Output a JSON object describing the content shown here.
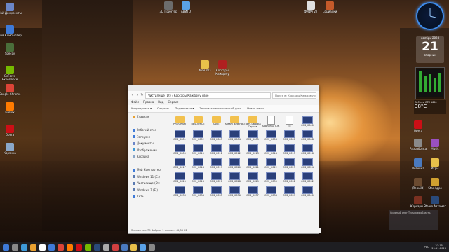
{
  "desktop_left": [
    {
      "label": "Мой Документы",
      "color": "#6b86c8"
    },
    {
      "label": "Мой Компьютер",
      "color": "#3e7ad8"
    },
    {
      "label": "Speccy",
      "color": "#4a6e3a"
    },
    {
      "label": "GeForce Experience",
      "color": "#76b900"
    },
    {
      "label": "Google Chrome",
      "color": "#db4437"
    },
    {
      "label": "Firefox",
      "color": "#ff7b00"
    },
    {
      "label": "Opera",
      "color": "#cc0f16"
    },
    {
      "label": "Корзина",
      "color": "#8aa7c8"
    }
  ],
  "desktop_top": [
    {
      "label": "3D Принтер",
      "color": "#6c6c6c"
    },
    {
      "label": "АВИТО",
      "color": "#5aa2e8"
    },
    {
      "label": "ФИФА 22",
      "color": "#e0e0e0"
    },
    {
      "label": "Социалки",
      "color": "#c45a2a"
    },
    {
      "label": "Мои ICO",
      "color": "#e8c04a"
    },
    {
      "label": "Корсары Каждому",
      "color": "#b02020"
    }
  ],
  "desktop_right": [
    {
      "label": "Opera",
      "color": "#cc0f16"
    },
    {
      "label": "Разработка",
      "color": "#8a8a8a"
    },
    {
      "label": "Music",
      "color": "#9a50c0"
    },
    {
      "label": "Всячина",
      "color": "#4a7ac0"
    },
    {
      "label": "Игры",
      "color": "#e8c04a"
    },
    {
      "label": "(Rebuild)",
      "color": "#6a4a30"
    },
    {
      "label": "Star Apps",
      "color": "#d0a030"
    },
    {
      "label": "Корсары 3",
      "color": "#7a3020"
    },
    {
      "label": "Steam Автомат",
      "color": "#2a4a7a"
    }
  ],
  "explorer": {
    "path": "Чистилище (D:)  ›  Корсары Каждому свое  ›",
    "search_placeholder": "Поиск в: Корсары Каждому с...",
    "menu": [
      "Файл",
      "Правка",
      "Вид",
      "Сервис"
    ],
    "toolbar": [
      "Упорядочить ▾",
      "Открыть",
      "Поделиться ▾",
      "Записать на оптический диск",
      "Новая папка"
    ],
    "sidebar": [
      {
        "label": "Главная",
        "color": "#e8a030"
      },
      {
        "label": "",
        "color": "transparent"
      },
      {
        "label": "Рабочий стол",
        "color": "#3e7ad8"
      },
      {
        "label": "Загрузки",
        "color": "#3e7ad8"
      },
      {
        "label": "Документы",
        "color": "#6b86c8"
      },
      {
        "label": "Изображения",
        "color": "#3e9ad8"
      },
      {
        "label": "Корзина",
        "color": "#8aa7c8"
      },
      {
        "label": "",
        "color": "transparent"
      },
      {
        "label": "Мой Компьютер",
        "color": "#3e7ad8"
      },
      {
        "label": "Windows 11 (C:)",
        "color": "#5a7ab0"
      },
      {
        "label": "Чистилище (D:)",
        "color": "#5a7ab0"
      },
      {
        "label": "Windows 7 (E:)",
        "color": "#5a7ab0"
      },
      {
        "label": "Сеть",
        "color": "#3e7ad8"
      }
    ],
    "items": [
      {
        "label": "PROGRAM",
        "kind": "folder"
      },
      {
        "label": "RESOURCE",
        "kind": "folder"
      },
      {
        "label": "SAVE",
        "kind": "folder"
      },
      {
        "label": "steam_settings",
        "kind": "folder"
      },
      {
        "label": "Патч-Сборка Сарсоз",
        "kind": "folder"
      },
      {
        "label": "SophonsCTOK",
        "kind": "doc"
      },
      {
        "label": "Tix",
        "kind": "doc"
      },
      {
        "label": "CCS_0000",
        "kind": "thumb"
      },
      {
        "label": "CCS_0001",
        "kind": "thumb"
      },
      {
        "label": "CCS_0002",
        "kind": "thumb"
      },
      {
        "label": "CCS_0003",
        "kind": "thumb"
      },
      {
        "label": "CCS_0004",
        "kind": "thumb"
      },
      {
        "label": "CCS_0005",
        "kind": "thumb"
      },
      {
        "label": "CCS_0006",
        "kind": "thumb"
      },
      {
        "label": "CCS_0007",
        "kind": "thumb"
      },
      {
        "label": "CCS_0008",
        "kind": "thumb"
      },
      {
        "label": "CCS_0009",
        "kind": "thumb"
      },
      {
        "label": "CCS_0010",
        "kind": "thumb"
      },
      {
        "label": "CCS_0011",
        "kind": "thumb"
      },
      {
        "label": "CCS_0012",
        "kind": "thumb"
      },
      {
        "label": "CCS_0013",
        "kind": "thumb"
      },
      {
        "label": "CCS_0014",
        "kind": "thumb"
      },
      {
        "label": "CCS_0015",
        "kind": "thumb"
      },
      {
        "label": "CCS_0016",
        "kind": "thumb"
      },
      {
        "label": "CCS_0017",
        "kind": "thumb"
      },
      {
        "label": "CCS_0018",
        "kind": "thumb"
      },
      {
        "label": "CCS_0019",
        "kind": "thumb"
      },
      {
        "label": "CCS_0020",
        "kind": "thumb"
      },
      {
        "label": "CCS_0021",
        "kind": "thumb"
      },
      {
        "label": "CCS_0022",
        "kind": "thumb"
      },
      {
        "label": "CCS_0023",
        "kind": "thumb"
      },
      {
        "label": "CCS_0024",
        "kind": "thumb"
      },
      {
        "label": "CCS_0025",
        "kind": "thumb"
      },
      {
        "label": "CCS_0026",
        "kind": "thumb"
      },
      {
        "label": "CCS_0027",
        "kind": "thumb"
      },
      {
        "label": "CCS_0028",
        "kind": "thumb"
      },
      {
        "label": "CCS_0029",
        "kind": "thumb"
      },
      {
        "label": "CCS_0030",
        "kind": "thumb"
      },
      {
        "label": "CCS_0031",
        "kind": "thumb"
      },
      {
        "label": "CCS_0032",
        "kind": "thumb"
      },
      {
        "label": "CCS_0033",
        "kind": "thumb"
      },
      {
        "label": "CCS_0034",
        "kind": "thumb"
      },
      {
        "label": "CCS_0035",
        "kind": "thumb"
      },
      {
        "label": "CCS_0036",
        "kind": "thumb"
      },
      {
        "label": "CCS_0037",
        "kind": "thumb"
      },
      {
        "label": "CCS_0038",
        "kind": "thumb"
      },
      {
        "label": "CCS_0039",
        "kind": "thumb"
      },
      {
        "label": "CCS_0040",
        "kind": "thumb"
      }
    ],
    "status": "Элементов: 79     Выбран 1 элемент: 6,33 КБ"
  },
  "gadgets": {
    "calendar_month": "ноябрь 2023",
    "calendar_day": "21",
    "calendar_weekday": "вторник",
    "gpu_name": "GeForce GTX 1650",
    "gpu_temp": "38°C",
    "weather": "Сильный снег  Тульская область"
  },
  "taskbar": {
    "apps": [
      "#3e7ad8",
      "#888",
      "#3e9ad8",
      "#e8a030",
      "#fff",
      "#3e7ad8",
      "#db4437",
      "#ff7b00",
      "#cc0f16",
      "#76b900",
      "#2a4a7a",
      "#aaa",
      "#d04040",
      "#4a7ac0",
      "#e8c04a",
      "#5aa2e8",
      "#888"
    ],
    "lang": "РУС",
    "time": "23:15",
    "date": "21.11.2023"
  }
}
